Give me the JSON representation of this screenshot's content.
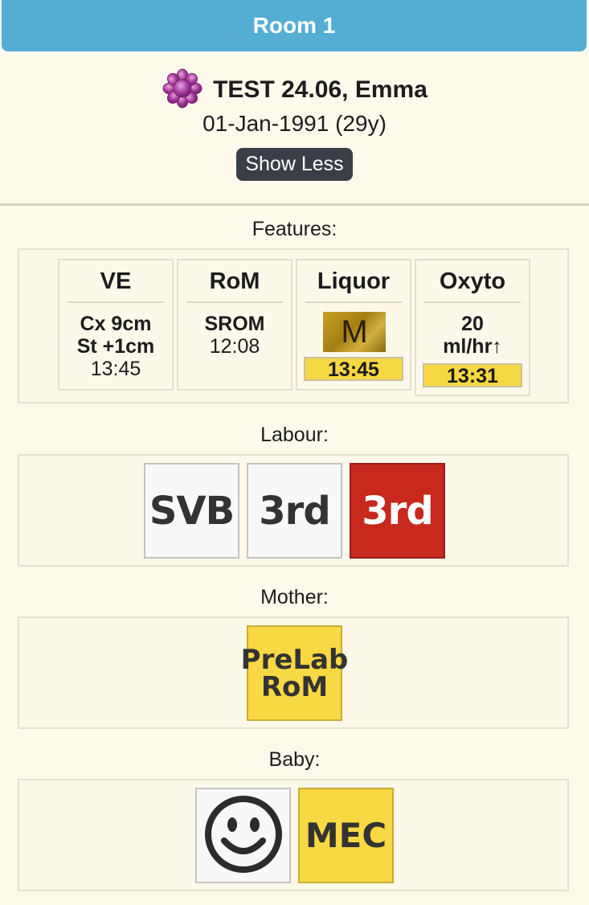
{
  "header": {
    "room": "Room 1"
  },
  "patient": {
    "name": "TEST 24.06, Emma",
    "dob_age": "01-Jan-1991 (29y)",
    "toggle_label": "Show Less",
    "icon": "flower-icon"
  },
  "features": {
    "label": "Features:",
    "ve": {
      "title": "VE",
      "line1": "Cx 9cm",
      "line2": "St +1cm",
      "time": "13:45"
    },
    "rom": {
      "title": "RoM",
      "line1": "SROM",
      "time": "12:08"
    },
    "liquor": {
      "title": "Liquor",
      "code": "M",
      "time": "13:45"
    },
    "oxyto": {
      "title": "Oxyto",
      "line1": "20",
      "line2": "ml/hr↑",
      "time": "13:31"
    }
  },
  "labour": {
    "label": "Labour:",
    "tiles": [
      "SVB",
      "3rd",
      "3rd"
    ]
  },
  "mother": {
    "label": "Mother:",
    "tile_line1": "PreLab",
    "tile_line2": "RoM"
  },
  "baby": {
    "label": "Baby:",
    "tile_icon": "smiley-icon",
    "tile_text": "MEC"
  },
  "colors": {
    "header_bg": "#54aed3",
    "page_bg": "#fdfaec",
    "badge_yellow": "#f6d843",
    "alert_red": "#c9281d",
    "button_dark": "#3a3f47"
  }
}
